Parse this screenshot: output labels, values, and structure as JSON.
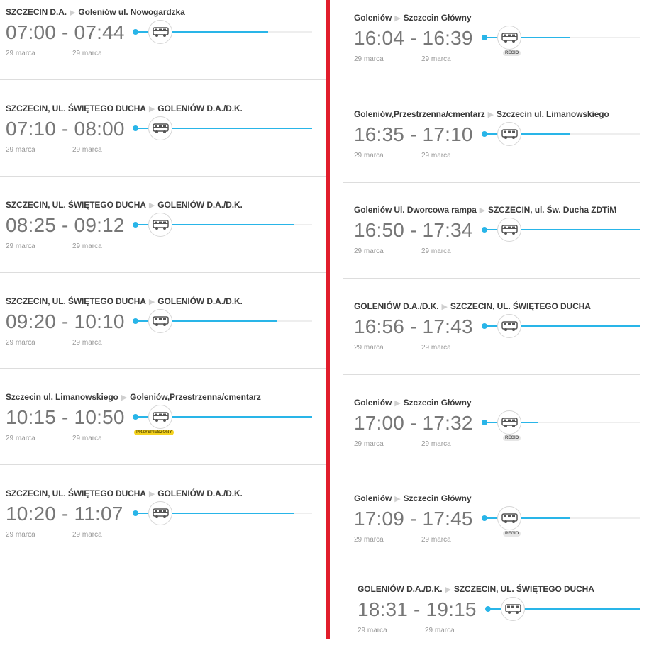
{
  "colors": {
    "accent": "#29b5e8",
    "divider": "#e11d2b",
    "badge_fast": "#f4d21f",
    "badge_regio": "#e6e6e6"
  },
  "icon": "bus-icon",
  "left_trips": [
    {
      "from": "SZCZECIN D.A.",
      "to": "Goleniów ul. Nowogardzka",
      "times": "07:00 - 07:44",
      "dep_date": "29 marca",
      "arr_date": "29 marca",
      "badge": "",
      "progress": 0.75
    },
    {
      "from": "SZCZECIN, UL. ŚWIĘTEGO DUCHA",
      "to": "GOLENIÓW D.A./D.K.",
      "times": "07:10 - 08:00",
      "dep_date": "29 marca",
      "arr_date": "29 marca",
      "badge": "",
      "progress": 1.0
    },
    {
      "from": "SZCZECIN, UL. ŚWIĘTEGO DUCHA",
      "to": "GOLENIÓW D.A./D.K.",
      "times": "08:25 - 09:12",
      "dep_date": "29 marca",
      "arr_date": "29 marca",
      "badge": "",
      "progress": 0.9
    },
    {
      "from": "SZCZECIN, UL. ŚWIĘTEGO DUCHA",
      "to": "GOLENIÓW D.A./D.K.",
      "times": "09:20 - 10:10",
      "dep_date": "29 marca",
      "arr_date": "29 marca",
      "badge": "",
      "progress": 0.8
    },
    {
      "from": "Szczecin ul. Limanowskiego",
      "to": "Goleniów,Przestrzenna/cmentarz",
      "times": "10:15 - 10:50",
      "dep_date": "29 marca",
      "arr_date": "29 marca",
      "badge": "PRZYSPIESZONY",
      "progress": 1.0
    },
    {
      "from": "SZCZECIN, UL. ŚWIĘTEGO DUCHA",
      "to": "GOLENIÓW D.A./D.K.",
      "times": "10:20 - 11:07",
      "dep_date": "29 marca",
      "arr_date": "29 marca",
      "badge": "",
      "progress": 0.9
    }
  ],
  "right_trips": [
    {
      "from": "Goleniów",
      "to": "Szczecin Główny",
      "times": "16:04 - 16:39",
      "dep_date": "29 marca",
      "arr_date": "29 marca",
      "badge": "REGIO",
      "progress": 0.55
    },
    {
      "from": "Goleniów,Przestrzenna/cmentarz",
      "to": "Szczecin ul. Limanowskiego",
      "times": "16:35 - 17:10",
      "dep_date": "29 marca",
      "arr_date": "29 marca",
      "badge": "",
      "progress": 0.55
    },
    {
      "from": "Goleniów Ul. Dworcowa rampa",
      "to": "SZCZECIN, ul. Św. Ducha ZDTiM",
      "times": "16:50 - 17:34",
      "dep_date": "29 marca",
      "arr_date": "29 marca",
      "badge": "",
      "progress": 1.0
    },
    {
      "from": "GOLENIÓW D.A./D.K.",
      "to": "SZCZECIN, UL. ŚWIĘTEGO DUCHA",
      "times": "16:56 - 17:43",
      "dep_date": "29 marca",
      "arr_date": "29 marca",
      "badge": "",
      "progress": 1.0
    },
    {
      "from": "Goleniów",
      "to": "Szczecin Główny",
      "times": "17:00 - 17:32",
      "dep_date": "29 marca",
      "arr_date": "29 marca",
      "badge": "REGIO",
      "progress": 0.35
    },
    {
      "from": "Goleniów",
      "to": "Szczecin Główny",
      "times": "17:09 - 17:45",
      "dep_date": "29 marca",
      "arr_date": "29 marca",
      "badge": "REGIO",
      "progress": 0.55
    },
    {
      "from": "GOLENIÓW D.A./D.K.",
      "to": "SZCZECIN, UL. ŚWIĘTEGO DUCHA",
      "times": "18:31 - 19:15",
      "dep_date": "29 marca",
      "arr_date": "29 marca",
      "badge": "",
      "progress": 1.0
    }
  ]
}
